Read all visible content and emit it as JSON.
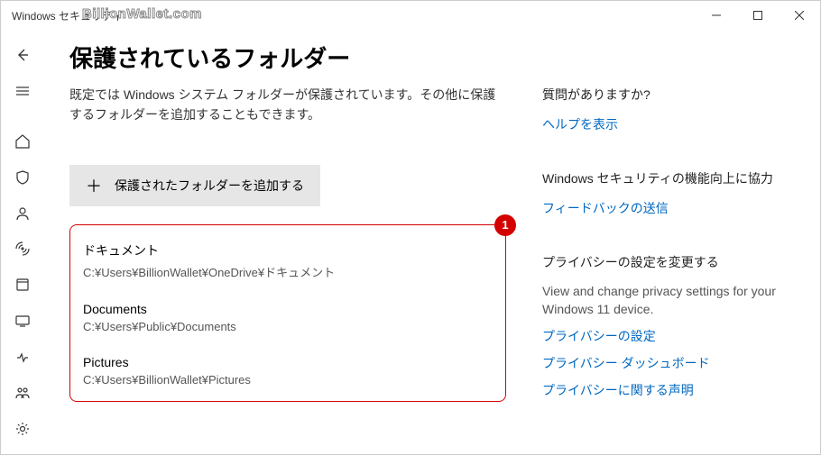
{
  "window": {
    "title": "Windows セキュリティ",
    "watermark": "BillionWallet.com"
  },
  "page": {
    "title": "保護されているフォルダー",
    "description": "既定では Windows システム フォルダーが保護されています。その他に保護するフォルダーを追加することもできます。",
    "add_button": "保護されたフォルダーを追加する",
    "badge": "1"
  },
  "folders": [
    {
      "title": "ドキュメント",
      "path": "C:¥Users¥BillionWallet¥OneDrive¥ドキュメント"
    },
    {
      "title": "Documents",
      "path": "C:¥Users¥Public¥Documents"
    },
    {
      "title": "Pictures",
      "path": "C:¥Users¥BillionWallet¥Pictures"
    }
  ],
  "aside": {
    "help": {
      "heading": "質問がありますか?",
      "link": "ヘルプを表示"
    },
    "feedback": {
      "heading": "Windows セキュリティの機能向上に協力",
      "link": "フィードバックの送信"
    },
    "privacy": {
      "heading": "プライバシーの設定を変更する",
      "text": "View and change privacy settings for your Windows 11 device.",
      "links": [
        "プライバシーの設定",
        "プライバシー ダッシュボード",
        "プライバシーに関する声明"
      ]
    }
  }
}
